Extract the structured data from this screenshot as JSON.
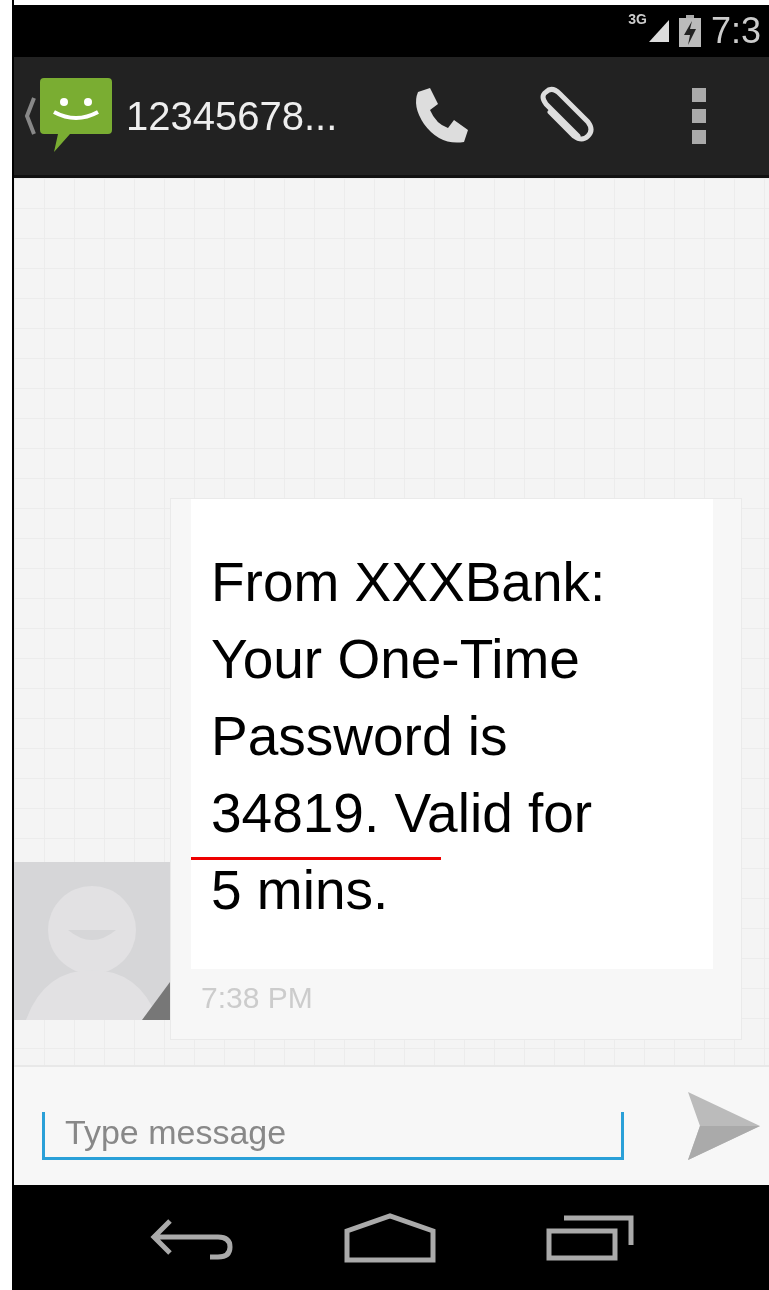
{
  "status_bar": {
    "network": "3G",
    "time": "7:3"
  },
  "action_bar": {
    "contact": "12345678..."
  },
  "messages": [
    {
      "kind": "incoming",
      "text": "From XXXBank: Your One-Time Password is 34819. Valid for 5 mins.",
      "time": "7:38 PM",
      "otp_underlined": true
    }
  ],
  "composer": {
    "placeholder": "Type message"
  }
}
